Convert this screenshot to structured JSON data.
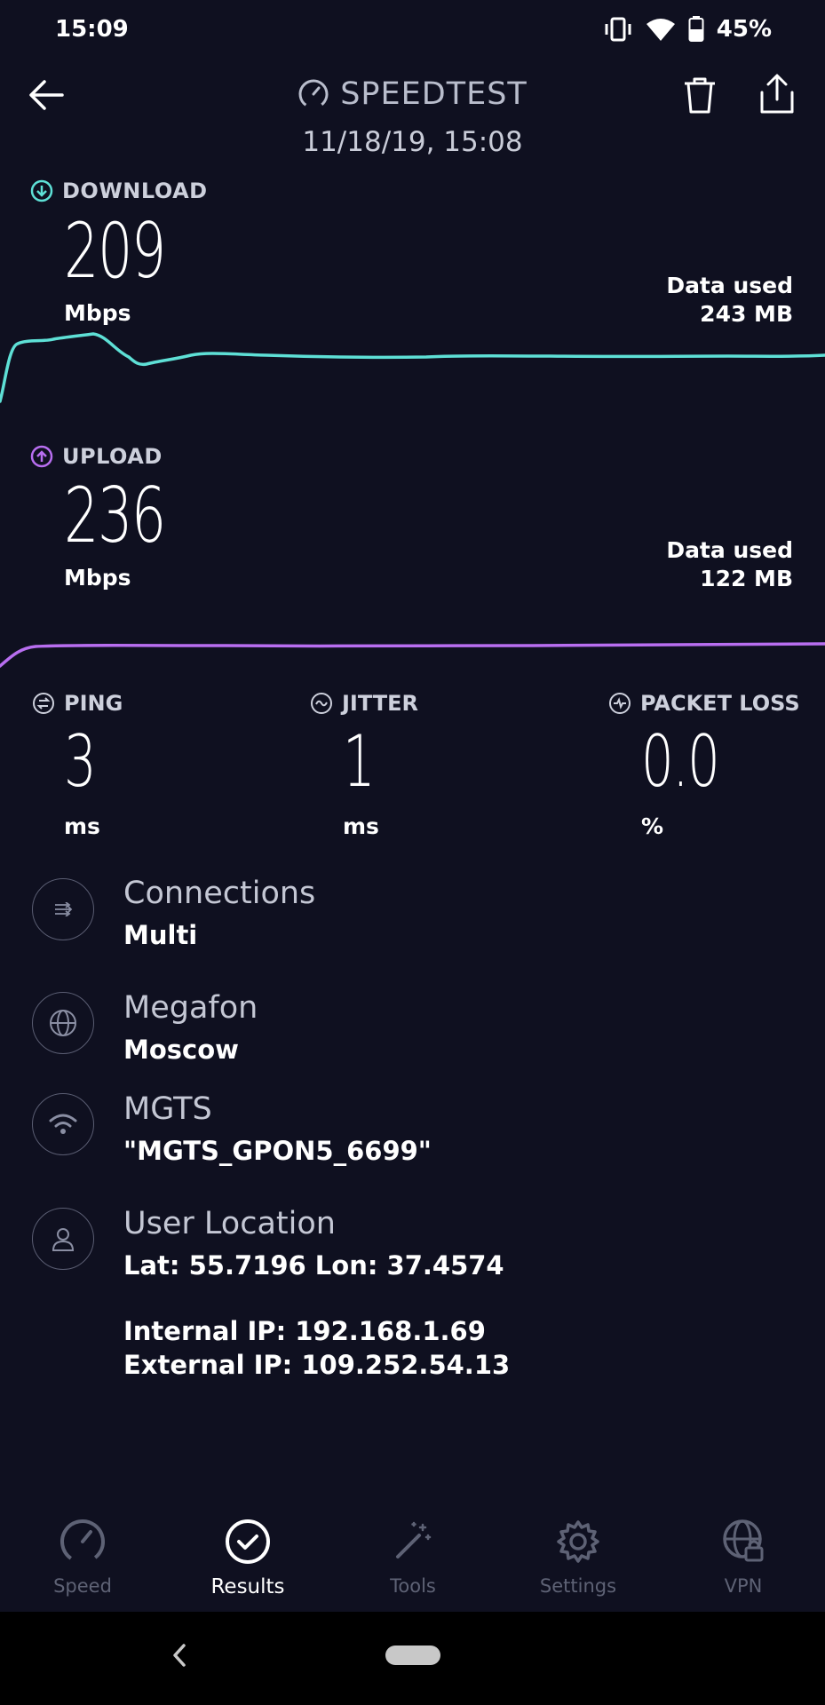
{
  "status_bar": {
    "time": "15:09",
    "battery": "45%"
  },
  "header": {
    "title": "SPEEDTEST",
    "date": "11/18/19, 15:08"
  },
  "download": {
    "label": "DOWNLOAD",
    "value": "209",
    "unit": "Mbps",
    "data_used_label": "Data used",
    "data_used_value": "243 MB"
  },
  "upload": {
    "label": "UPLOAD",
    "value": "236",
    "unit": "Mbps",
    "data_used_label": "Data used",
    "data_used_value": "122 MB"
  },
  "metrics": {
    "ping": {
      "label": "PING",
      "value": "3",
      "unit": "ms"
    },
    "jitter": {
      "label": "JITTER",
      "value": "1",
      "unit": "ms"
    },
    "packet_loss": {
      "label": "PACKET LOSS",
      "value": "0.0",
      "unit": "%"
    }
  },
  "info": {
    "connections": {
      "title": "Connections",
      "value": "Multi"
    },
    "server": {
      "title": "Megafon",
      "value": "Moscow"
    },
    "network": {
      "title": "MGTS",
      "value": "\"MGTS_GPON5_6699\""
    },
    "location": {
      "title": "User Location",
      "value": "Lat: 55.7196 Lon: 37.4574",
      "internal_ip": "Internal IP: 192.168.1.69",
      "external_ip": "External IP: 109.252.54.13"
    }
  },
  "nav": {
    "speed": "Speed",
    "results": "Results",
    "tools": "Tools",
    "settings": "Settings",
    "vpn": "VPN",
    "active": "results"
  },
  "colors": {
    "background": "#0f1020",
    "download": "#5ee0d6",
    "upload": "#b86ef0"
  }
}
